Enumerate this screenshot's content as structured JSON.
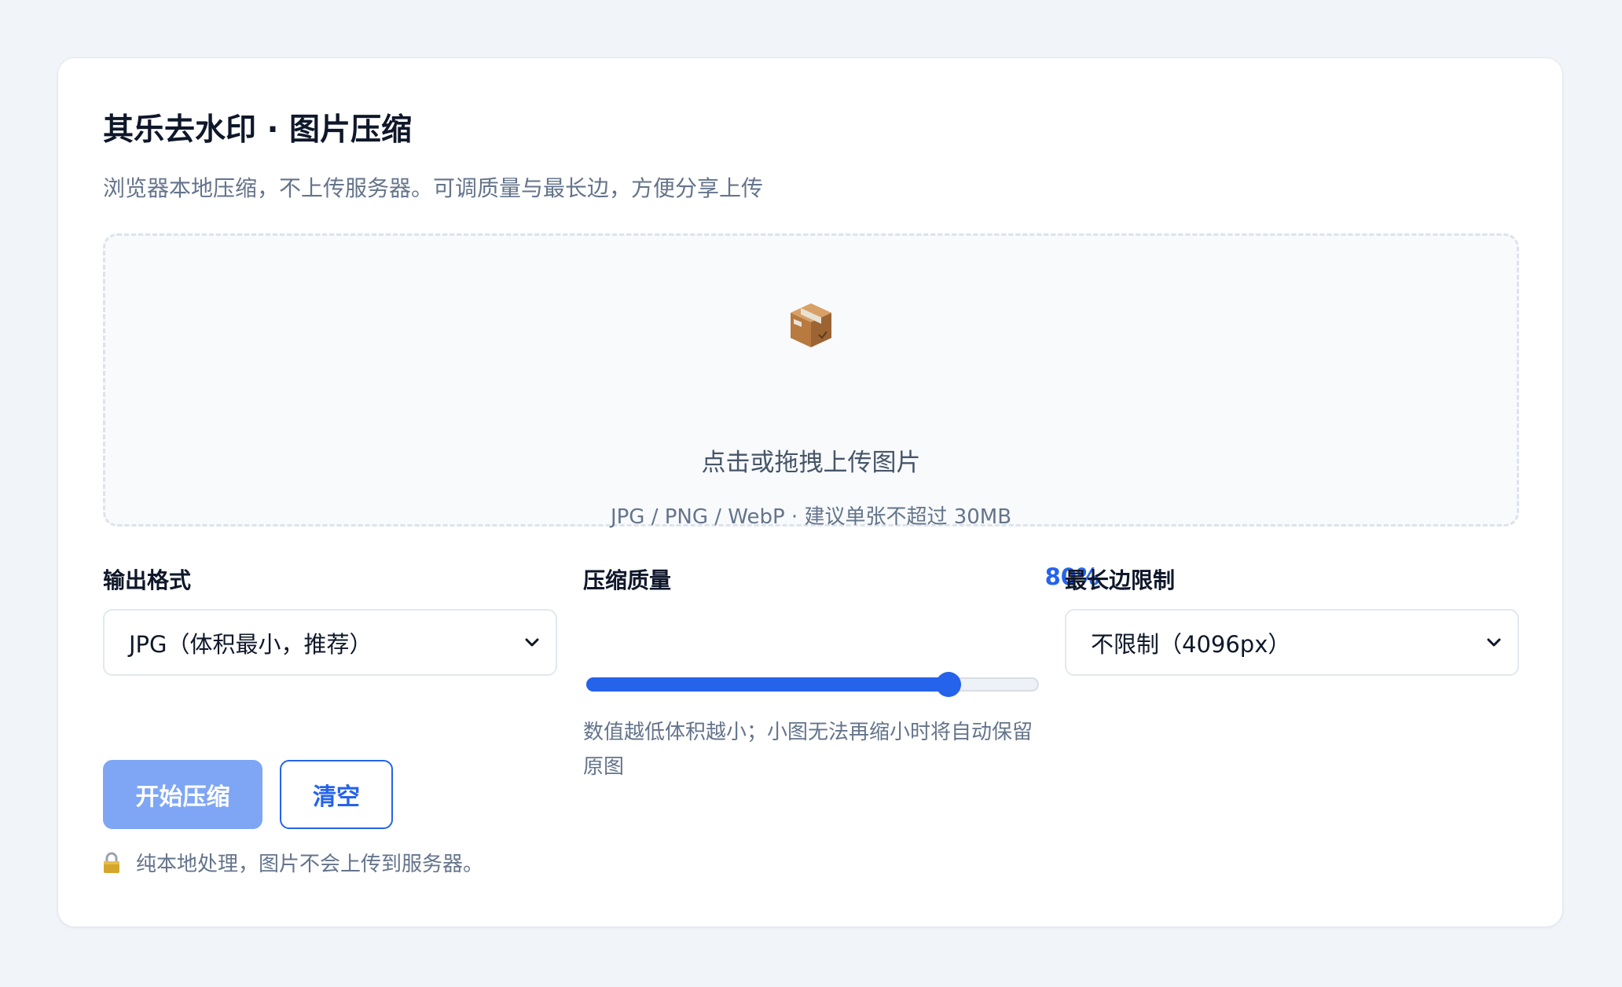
{
  "page": {
    "title": "其乐去水印 · 图片压缩",
    "subtitle": "浏览器本地压缩，不上传服务器。可调质量与最长边，方便分享上传"
  },
  "dropzone": {
    "icon": "package-icon",
    "text": "点击或拖拽上传图片",
    "hint": "JPG / PNG / WebP · 建议单张不超过 30MB"
  },
  "format": {
    "label": "输出格式",
    "selected": "JPG（体积最小，推荐）"
  },
  "quality": {
    "label": "压缩质量",
    "value_text": "80%",
    "value": 0.8,
    "hint": "数值越低体积越小；小图无法再缩小时将自动保留原图"
  },
  "max_edge": {
    "label": "最长边限制",
    "selected": "不限制（4096px）"
  },
  "actions": {
    "start_label": "开始压缩",
    "clear_label": "清空"
  },
  "footer_note": {
    "icon": "lock-icon",
    "text": "纯本地处理，图片不会上传到服务器。"
  },
  "colors": {
    "accent": "#2563eb",
    "primary_disabled": "#7fa6f5",
    "background": "#f1f4f9"
  }
}
